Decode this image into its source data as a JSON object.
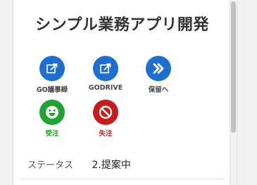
{
  "app": {
    "title": "シンプル業務アプリ開発"
  },
  "actions": [
    {
      "id": "go-gijiroku",
      "label": "GO議事録",
      "icon": "edit-external-icon",
      "bg": "#1f6fd1",
      "label_color": "#444444"
    },
    {
      "id": "godrive",
      "label": "GODRIVE",
      "icon": "edit-external-icon",
      "bg": "#1f6fd1",
      "label_color": "#444444"
    },
    {
      "id": "horyu",
      "label": "保留へ",
      "icon": "chevron-double-right-icon",
      "bg": "#1f6fd1",
      "label_color": "#444444"
    },
    {
      "id": "juchu",
      "label": "受注",
      "icon": "smiley-icon",
      "bg": "#1ea42f",
      "label_color": "#1ea42f"
    },
    {
      "id": "shitchu",
      "label": "失注",
      "icon": "prohibited-icon",
      "bg": "#c81b1b",
      "label_color": "#c81b1b"
    }
  ],
  "status": {
    "label": "ステータス",
    "value": "2.提案中"
  }
}
